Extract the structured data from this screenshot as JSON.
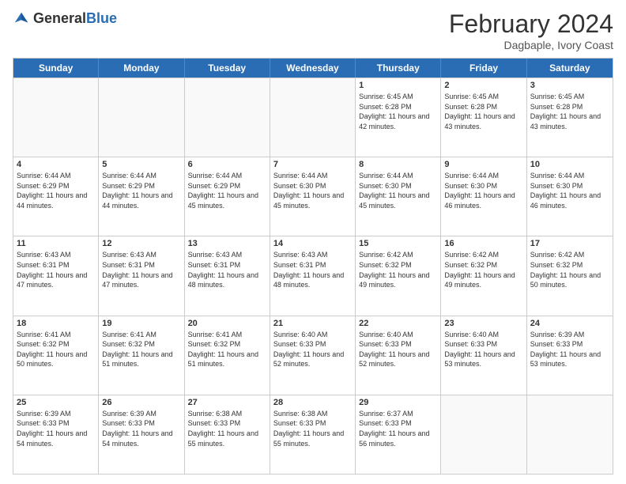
{
  "logo": {
    "general": "General",
    "blue": "Blue"
  },
  "title": {
    "month": "February 2024",
    "location": "Dagbaple, Ivory Coast"
  },
  "header_days": [
    "Sunday",
    "Monday",
    "Tuesday",
    "Wednesday",
    "Thursday",
    "Friday",
    "Saturday"
  ],
  "weeks": [
    [
      {
        "day": "",
        "sunrise": "",
        "sunset": "",
        "daylight": ""
      },
      {
        "day": "",
        "sunrise": "",
        "sunset": "",
        "daylight": ""
      },
      {
        "day": "",
        "sunrise": "",
        "sunset": "",
        "daylight": ""
      },
      {
        "day": "",
        "sunrise": "",
        "sunset": "",
        "daylight": ""
      },
      {
        "day": "1",
        "sunrise": "Sunrise: 6:45 AM",
        "sunset": "Sunset: 6:28 PM",
        "daylight": "Daylight: 11 hours and 42 minutes."
      },
      {
        "day": "2",
        "sunrise": "Sunrise: 6:45 AM",
        "sunset": "Sunset: 6:28 PM",
        "daylight": "Daylight: 11 hours and 43 minutes."
      },
      {
        "day": "3",
        "sunrise": "Sunrise: 6:45 AM",
        "sunset": "Sunset: 6:28 PM",
        "daylight": "Daylight: 11 hours and 43 minutes."
      }
    ],
    [
      {
        "day": "4",
        "sunrise": "Sunrise: 6:44 AM",
        "sunset": "Sunset: 6:29 PM",
        "daylight": "Daylight: 11 hours and 44 minutes."
      },
      {
        "day": "5",
        "sunrise": "Sunrise: 6:44 AM",
        "sunset": "Sunset: 6:29 PM",
        "daylight": "Daylight: 11 hours and 44 minutes."
      },
      {
        "day": "6",
        "sunrise": "Sunrise: 6:44 AM",
        "sunset": "Sunset: 6:29 PM",
        "daylight": "Daylight: 11 hours and 45 minutes."
      },
      {
        "day": "7",
        "sunrise": "Sunrise: 6:44 AM",
        "sunset": "Sunset: 6:30 PM",
        "daylight": "Daylight: 11 hours and 45 minutes."
      },
      {
        "day": "8",
        "sunrise": "Sunrise: 6:44 AM",
        "sunset": "Sunset: 6:30 PM",
        "daylight": "Daylight: 11 hours and 45 minutes."
      },
      {
        "day": "9",
        "sunrise": "Sunrise: 6:44 AM",
        "sunset": "Sunset: 6:30 PM",
        "daylight": "Daylight: 11 hours and 46 minutes."
      },
      {
        "day": "10",
        "sunrise": "Sunrise: 6:44 AM",
        "sunset": "Sunset: 6:30 PM",
        "daylight": "Daylight: 11 hours and 46 minutes."
      }
    ],
    [
      {
        "day": "11",
        "sunrise": "Sunrise: 6:43 AM",
        "sunset": "Sunset: 6:31 PM",
        "daylight": "Daylight: 11 hours and 47 minutes."
      },
      {
        "day": "12",
        "sunrise": "Sunrise: 6:43 AM",
        "sunset": "Sunset: 6:31 PM",
        "daylight": "Daylight: 11 hours and 47 minutes."
      },
      {
        "day": "13",
        "sunrise": "Sunrise: 6:43 AM",
        "sunset": "Sunset: 6:31 PM",
        "daylight": "Daylight: 11 hours and 48 minutes."
      },
      {
        "day": "14",
        "sunrise": "Sunrise: 6:43 AM",
        "sunset": "Sunset: 6:31 PM",
        "daylight": "Daylight: 11 hours and 48 minutes."
      },
      {
        "day": "15",
        "sunrise": "Sunrise: 6:42 AM",
        "sunset": "Sunset: 6:32 PM",
        "daylight": "Daylight: 11 hours and 49 minutes."
      },
      {
        "day": "16",
        "sunrise": "Sunrise: 6:42 AM",
        "sunset": "Sunset: 6:32 PM",
        "daylight": "Daylight: 11 hours and 49 minutes."
      },
      {
        "day": "17",
        "sunrise": "Sunrise: 6:42 AM",
        "sunset": "Sunset: 6:32 PM",
        "daylight": "Daylight: 11 hours and 50 minutes."
      }
    ],
    [
      {
        "day": "18",
        "sunrise": "Sunrise: 6:41 AM",
        "sunset": "Sunset: 6:32 PM",
        "daylight": "Daylight: 11 hours and 50 minutes."
      },
      {
        "day": "19",
        "sunrise": "Sunrise: 6:41 AM",
        "sunset": "Sunset: 6:32 PM",
        "daylight": "Daylight: 11 hours and 51 minutes."
      },
      {
        "day": "20",
        "sunrise": "Sunrise: 6:41 AM",
        "sunset": "Sunset: 6:32 PM",
        "daylight": "Daylight: 11 hours and 51 minutes."
      },
      {
        "day": "21",
        "sunrise": "Sunrise: 6:40 AM",
        "sunset": "Sunset: 6:33 PM",
        "daylight": "Daylight: 11 hours and 52 minutes."
      },
      {
        "day": "22",
        "sunrise": "Sunrise: 6:40 AM",
        "sunset": "Sunset: 6:33 PM",
        "daylight": "Daylight: 11 hours and 52 minutes."
      },
      {
        "day": "23",
        "sunrise": "Sunrise: 6:40 AM",
        "sunset": "Sunset: 6:33 PM",
        "daylight": "Daylight: 11 hours and 53 minutes."
      },
      {
        "day": "24",
        "sunrise": "Sunrise: 6:39 AM",
        "sunset": "Sunset: 6:33 PM",
        "daylight": "Daylight: 11 hours and 53 minutes."
      }
    ],
    [
      {
        "day": "25",
        "sunrise": "Sunrise: 6:39 AM",
        "sunset": "Sunset: 6:33 PM",
        "daylight": "Daylight: 11 hours and 54 minutes."
      },
      {
        "day": "26",
        "sunrise": "Sunrise: 6:39 AM",
        "sunset": "Sunset: 6:33 PM",
        "daylight": "Daylight: 11 hours and 54 minutes."
      },
      {
        "day": "27",
        "sunrise": "Sunrise: 6:38 AM",
        "sunset": "Sunset: 6:33 PM",
        "daylight": "Daylight: 11 hours and 55 minutes."
      },
      {
        "day": "28",
        "sunrise": "Sunrise: 6:38 AM",
        "sunset": "Sunset: 6:33 PM",
        "daylight": "Daylight: 11 hours and 55 minutes."
      },
      {
        "day": "29",
        "sunrise": "Sunrise: 6:37 AM",
        "sunset": "Sunset: 6:33 PM",
        "daylight": "Daylight: 11 hours and 56 minutes."
      },
      {
        "day": "",
        "sunrise": "",
        "sunset": "",
        "daylight": ""
      },
      {
        "day": "",
        "sunrise": "",
        "sunset": "",
        "daylight": ""
      }
    ]
  ]
}
